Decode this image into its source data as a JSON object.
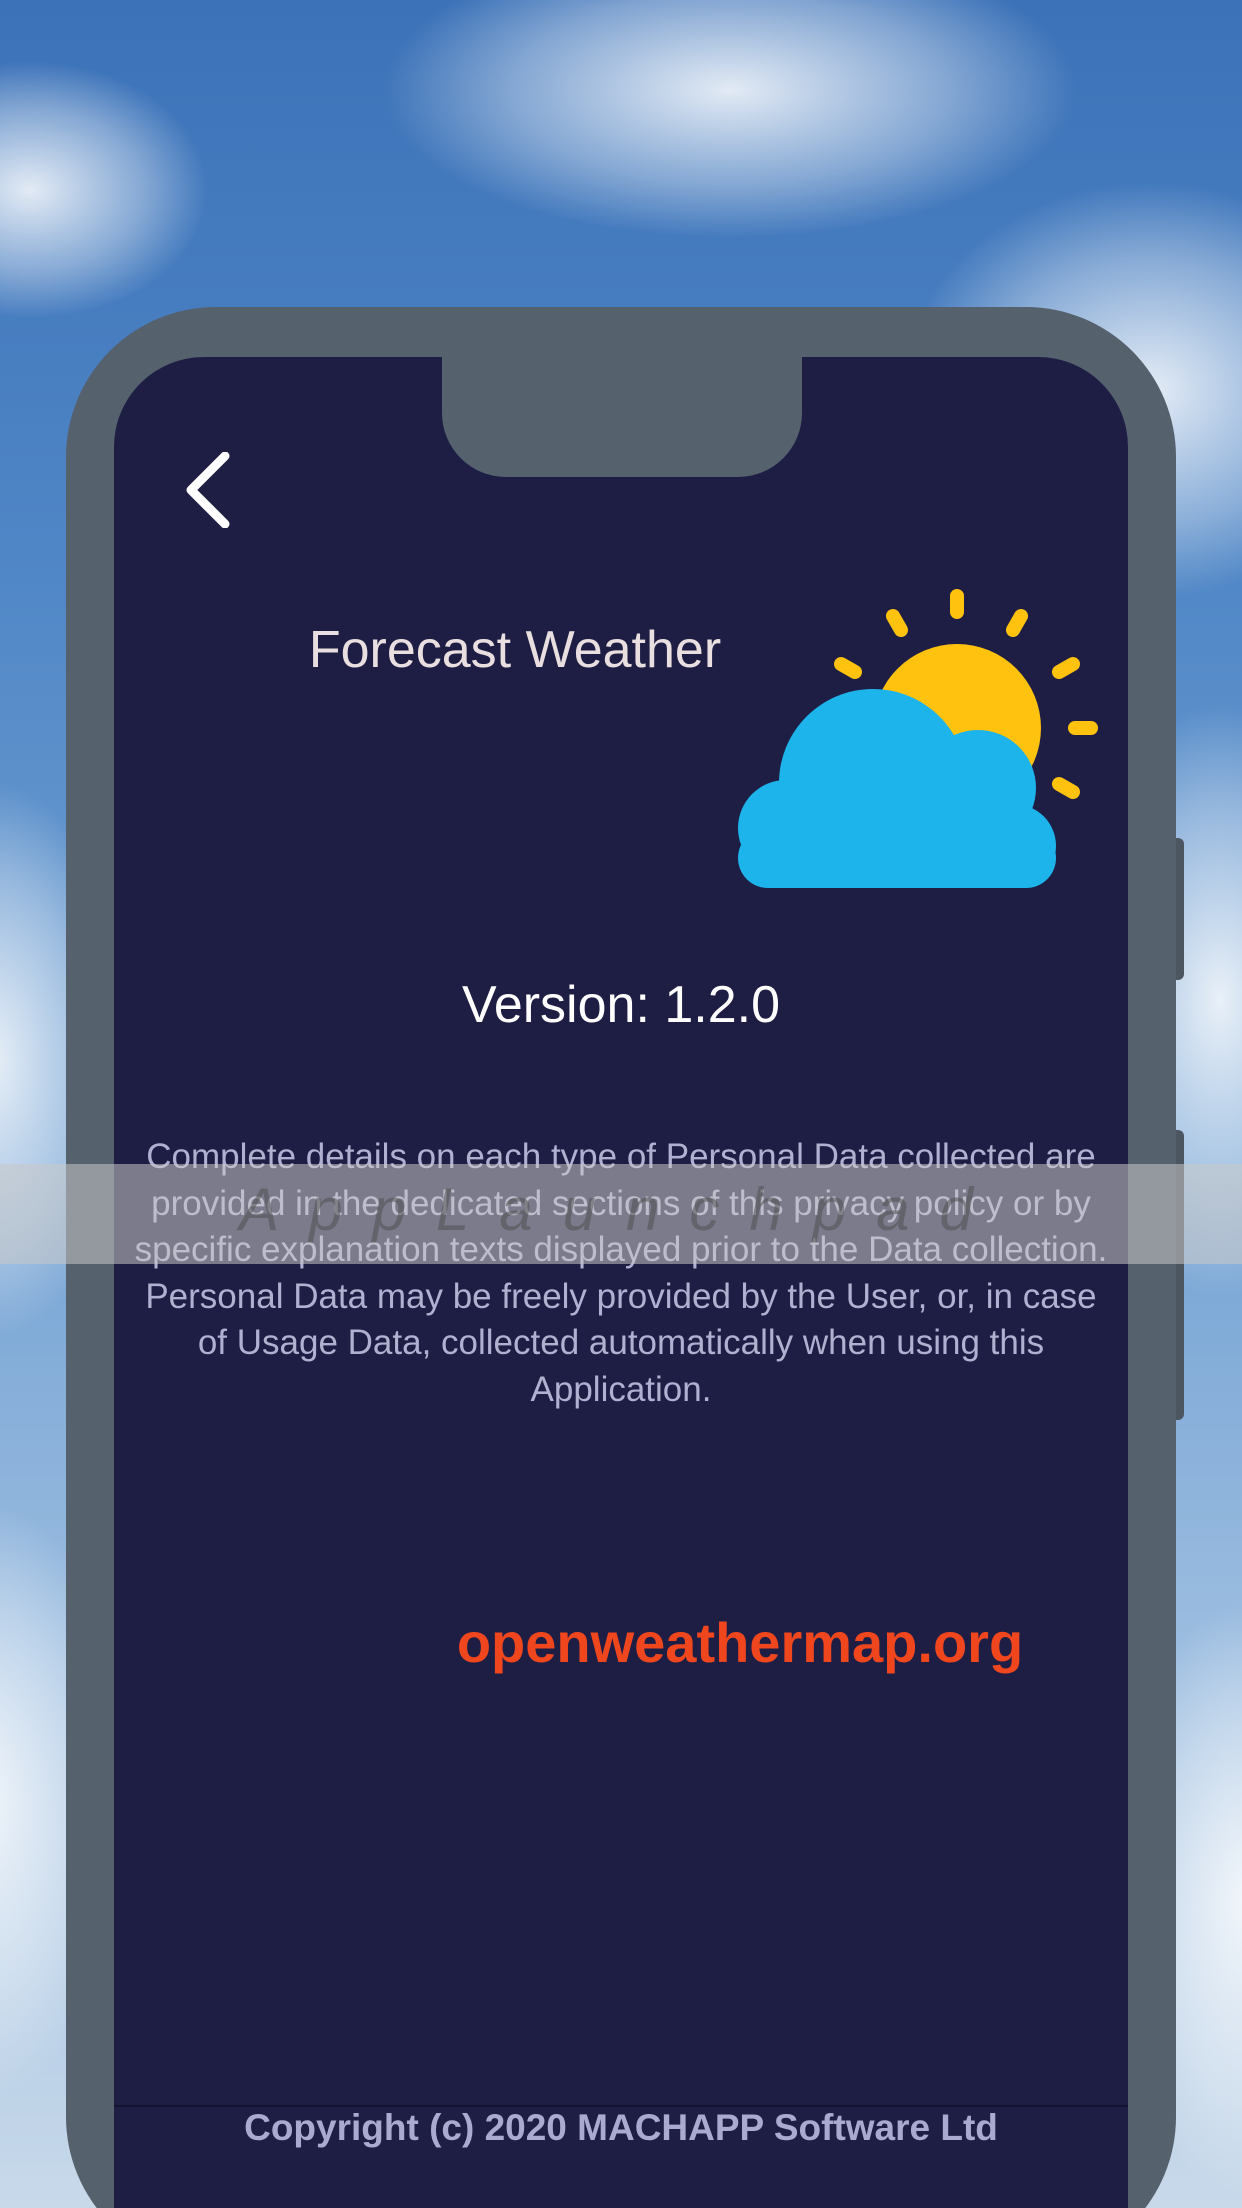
{
  "app": {
    "title": "Forecast Weather",
    "version_label": "Version: 1.2.0",
    "policy_text": "Complete details on each type of Personal Data collected are provided in the dedicated sections of this privacy policy or by specific explanation texts displayed prior to the Data collection. Personal Data may be freely provided by the User, or, in case of Usage Data, collected automatically when using this Application.",
    "link_text": "openweathermap.org",
    "copyright": "Copyright (c) 2020 MACHAPP Software Ltd"
  },
  "watermark": {
    "text": "AppLaunchpad"
  },
  "icons": {
    "back": "chevron-left-icon",
    "weather": "sun-behind-cloud-icon"
  },
  "colors": {
    "screen_background": "#1e1e44",
    "phone_frame": "#56616e",
    "link": "#f0461e",
    "sun": "#ffc20e",
    "cloud": "#1db4ec",
    "title_text": "#e9dfe0",
    "body_text": "#b0b0d0"
  }
}
